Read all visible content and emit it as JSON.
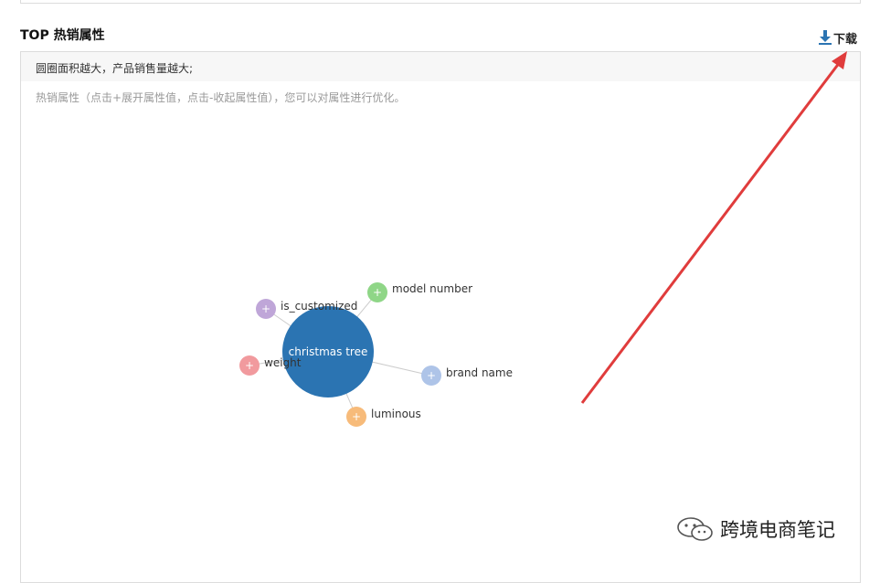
{
  "section": {
    "title": "TOP 热销属性"
  },
  "toolbar": {
    "download_label": "下载",
    "download_icon": "download-icon"
  },
  "panel": {
    "legend": "圆圈面积越大，产品销售量越大;",
    "hint": "热销属性（点击+展开属性值，点击-收起属性值），您可以对属性进行优化。"
  },
  "graph": {
    "center": {
      "label": "christmas tree",
      "color": "#2b74b2"
    },
    "nodes": [
      {
        "id": "model-number",
        "label": "model number",
        "symbol": "+",
        "color": "#8fd687"
      },
      {
        "id": "is-customized",
        "label": "is_customized",
        "symbol": "+",
        "color": "#bfa6d8"
      },
      {
        "id": "weight",
        "label": "weight",
        "symbol": "+",
        "color": "#f19a9e"
      },
      {
        "id": "brand-name",
        "label": "brand name",
        "symbol": "+",
        "color": "#aec4e8"
      },
      {
        "id": "luminous",
        "label": "luminous",
        "symbol": "+",
        "color": "#f7bb7a"
      }
    ],
    "link_color": "#cccccc"
  },
  "annotation": {
    "arrow_color": "#e03c3c"
  },
  "watermark": {
    "text": "跨境电商笔记"
  }
}
